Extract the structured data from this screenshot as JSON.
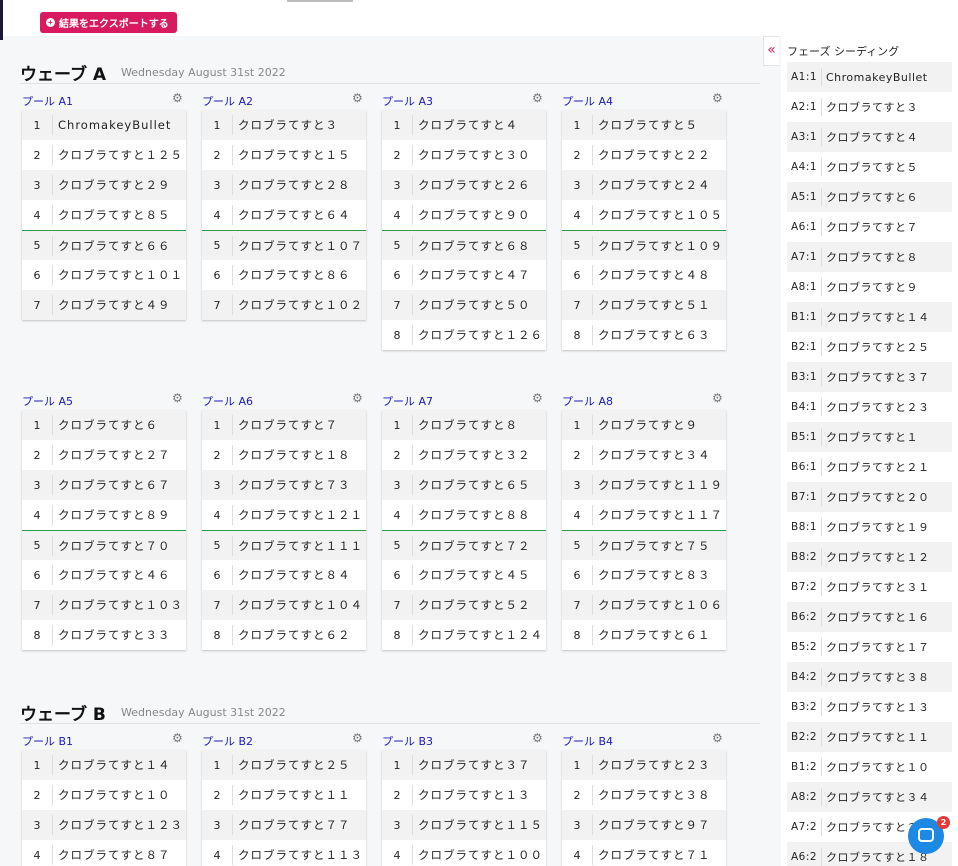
{
  "export_button": {
    "label": "結果をエクスポートする",
    "icon": "plus-circle-icon"
  },
  "waves": [
    {
      "title": "ウェーブ A",
      "date": "Wednesday August 31st 2022",
      "pools": [
        {
          "name": "プール A1",
          "entries": [
            [
              "1",
              "ChromakeyBullet"
            ],
            [
              "2",
              "クロブラてすと１２５"
            ],
            [
              "3",
              "クロブラてすと２９"
            ],
            [
              "4",
              "クロブラてすと８５"
            ],
            [
              "5",
              "クロブラてすと６６"
            ],
            [
              "6",
              "クロブラてすと１０１"
            ],
            [
              "7",
              "クロブラてすと４９"
            ]
          ]
        },
        {
          "name": "プール A2",
          "entries": [
            [
              "1",
              "クロブラてすと３"
            ],
            [
              "2",
              "クロブラてすと１５"
            ],
            [
              "3",
              "クロブラてすと２８"
            ],
            [
              "4",
              "クロブラてすと６４"
            ],
            [
              "5",
              "クロブラてすと１０７"
            ],
            [
              "6",
              "クロブラてすと８６"
            ],
            [
              "7",
              "クロブラてすと１０２"
            ]
          ]
        },
        {
          "name": "プール A3",
          "entries": [
            [
              "1",
              "クロブラてすと４"
            ],
            [
              "2",
              "クロブラてすと３０"
            ],
            [
              "3",
              "クロブラてすと２６"
            ],
            [
              "4",
              "クロブラてすと９０"
            ],
            [
              "5",
              "クロブラてすと６８"
            ],
            [
              "6",
              "クロブラてすと４７"
            ],
            [
              "7",
              "クロブラてすと５０"
            ],
            [
              "8",
              "クロブラてすと１２６"
            ]
          ]
        },
        {
          "name": "プール A4",
          "entries": [
            [
              "1",
              "クロブラてすと５"
            ],
            [
              "2",
              "クロブラてすと２２"
            ],
            [
              "3",
              "クロブラてすと２４"
            ],
            [
              "4",
              "クロブラてすと１０５"
            ],
            [
              "5",
              "クロブラてすと１０９"
            ],
            [
              "6",
              "クロブラてすと４８"
            ],
            [
              "7",
              "クロブラてすと５１"
            ],
            [
              "8",
              "クロブラてすと６３"
            ]
          ]
        },
        {
          "name": "プール A5",
          "entries": [
            [
              "1",
              "クロブラてすと６"
            ],
            [
              "2",
              "クロブラてすと２７"
            ],
            [
              "3",
              "クロブラてすと６７"
            ],
            [
              "4",
              "クロブラてすと８９"
            ],
            [
              "5",
              "クロブラてすと７０"
            ],
            [
              "6",
              "クロブラてすと４６"
            ],
            [
              "7",
              "クロブラてすと１０３"
            ],
            [
              "8",
              "クロブラてすと３３"
            ]
          ]
        },
        {
          "name": "プール A6",
          "entries": [
            [
              "1",
              "クロブラてすと７"
            ],
            [
              "2",
              "クロブラてすと１８"
            ],
            [
              "3",
              "クロブラてすと７３"
            ],
            [
              "4",
              "クロブラてすと１２１"
            ],
            [
              "5",
              "クロブラてすと１１１"
            ],
            [
              "6",
              "クロブラてすと８４"
            ],
            [
              "7",
              "クロブラてすと１０４"
            ],
            [
              "8",
              "クロブラてすと６２"
            ]
          ]
        },
        {
          "name": "プール A7",
          "entries": [
            [
              "1",
              "クロブラてすと８"
            ],
            [
              "2",
              "クロブラてすと３２"
            ],
            [
              "3",
              "クロブラてすと６５"
            ],
            [
              "4",
              "クロブラてすと８８"
            ],
            [
              "5",
              "クロブラてすと７２"
            ],
            [
              "6",
              "クロブラてすと４５"
            ],
            [
              "7",
              "クロブラてすと５２"
            ],
            [
              "8",
              "クロブラてすと１２４"
            ]
          ]
        },
        {
          "name": "プール A8",
          "entries": [
            [
              "1",
              "クロブラてすと９"
            ],
            [
              "2",
              "クロブラてすと３４"
            ],
            [
              "3",
              "クロブラてすと１１９"
            ],
            [
              "4",
              "クロブラてすと１１７"
            ],
            [
              "5",
              "クロブラてすと７５"
            ],
            [
              "6",
              "クロブラてすと８３"
            ],
            [
              "7",
              "クロブラてすと１０６"
            ],
            [
              "8",
              "クロブラてすと６１"
            ]
          ]
        }
      ]
    },
    {
      "title": "ウェーブ B",
      "date": "Wednesday August 31st 2022",
      "pools": [
        {
          "name": "プール B1",
          "entries": [
            [
              "1",
              "クロブラてすと１４"
            ],
            [
              "2",
              "クロブラてすと１０"
            ],
            [
              "3",
              "クロブラてすと１２３"
            ],
            [
              "4",
              "クロブラてすと８７"
            ]
          ]
        },
        {
          "name": "プール B2",
          "entries": [
            [
              "1",
              "クロブラてすと２５"
            ],
            [
              "2",
              "クロブラてすと１１"
            ],
            [
              "3",
              "クロブラてすと７７"
            ],
            [
              "4",
              "クロブラてすと１１３"
            ]
          ]
        },
        {
          "name": "プール B3",
          "entries": [
            [
              "1",
              "クロブラてすと３７"
            ],
            [
              "2",
              "クロブラてすと１３"
            ],
            [
              "3",
              "クロブラてすと１１５"
            ],
            [
              "4",
              "クロブラてすと１００"
            ]
          ]
        },
        {
          "name": "プール B4",
          "entries": [
            [
              "1",
              "クロブラてすと２３"
            ],
            [
              "2",
              "クロブラてすと３８"
            ],
            [
              "3",
              "クロブラてすと９７"
            ],
            [
              "4",
              "クロブラてすと７１"
            ]
          ]
        }
      ]
    }
  ],
  "advance_cutoff": 4,
  "sidebar": {
    "collapse_label": "«",
    "title": "フェーズ シーディング",
    "seeds": [
      [
        "A1:1",
        "ChromakeyBullet"
      ],
      [
        "A2:1",
        "クロブラてすと３"
      ],
      [
        "A3:1",
        "クロブラてすと４"
      ],
      [
        "A4:1",
        "クロブラてすと５"
      ],
      [
        "A5:1",
        "クロブラてすと６"
      ],
      [
        "A6:1",
        "クロブラてすと７"
      ],
      [
        "A7:1",
        "クロブラてすと８"
      ],
      [
        "A8:1",
        "クロブラてすと９"
      ],
      [
        "B1:1",
        "クロブラてすと１４"
      ],
      [
        "B2:1",
        "クロブラてすと２５"
      ],
      [
        "B3:1",
        "クロブラてすと３７"
      ],
      [
        "B4:1",
        "クロブラてすと２３"
      ],
      [
        "B5:1",
        "クロブラてすと１"
      ],
      [
        "B6:1",
        "クロブラてすと２１"
      ],
      [
        "B7:1",
        "クロブラてすと２０"
      ],
      [
        "B8:1",
        "クロブラてすと１９"
      ],
      [
        "B8:2",
        "クロブラてすと１２"
      ],
      [
        "B7:2",
        "クロブラてすと３１"
      ],
      [
        "B6:2",
        "クロブラてすと１６"
      ],
      [
        "B5:2",
        "クロブラてすと１７"
      ],
      [
        "B4:2",
        "クロブラてすと３８"
      ],
      [
        "B3:2",
        "クロブラてすと１３"
      ],
      [
        "B2:2",
        "クロブラてすと１１"
      ],
      [
        "B1:2",
        "クロブラてすと１０"
      ],
      [
        "A8:2",
        "クロブラてすと３４"
      ],
      [
        "A7:2",
        "クロブラてすと３２"
      ],
      [
        "A6:2",
        "クロブラてすと１８"
      ]
    ]
  },
  "chat": {
    "badge": "2",
    "icon": "chat-bubble-icon"
  },
  "colors": {
    "accent": "#d81b60",
    "link": "#1a1ab8",
    "cutoff_line": "#2e9d4b",
    "chat": "#1e88e5"
  }
}
